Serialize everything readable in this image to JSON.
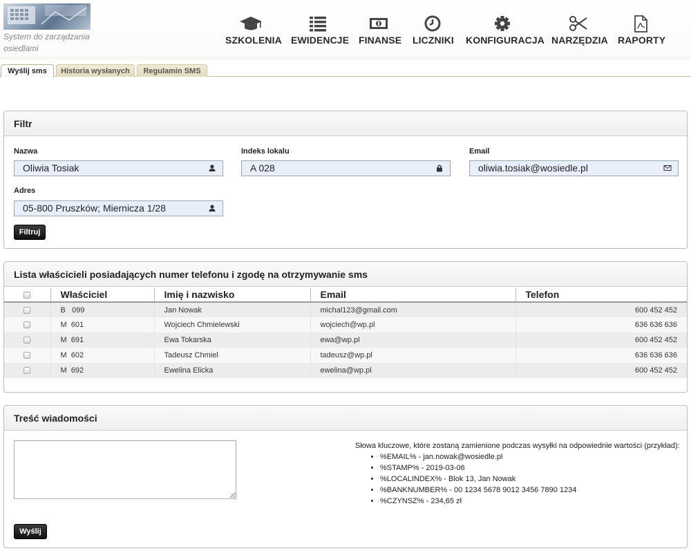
{
  "header": {
    "tagline": "System do zarządzania osiedlami",
    "nav": [
      {
        "label": "SZKOLENIA",
        "icon": "graduation-cap-icon"
      },
      {
        "label": "EWIDENCJE",
        "icon": "list-icon"
      },
      {
        "label": "FINANSE",
        "icon": "money-icon"
      },
      {
        "label": "LICZNIKI",
        "icon": "clock-icon"
      },
      {
        "label": "KONFIGURACJA",
        "icon": "gear-icon"
      },
      {
        "label": "NARZĘDZIA",
        "icon": "scissors-icon"
      },
      {
        "label": "RAPORTY",
        "icon": "pdf-file-icon"
      }
    ]
  },
  "tabs": [
    {
      "label": "Wyślij sms",
      "active": true
    },
    {
      "label": "Historia wysłanych",
      "active": false
    },
    {
      "label": "Regulamin SMS",
      "active": false
    }
  ],
  "filter": {
    "title": "Filtr",
    "nazwa": {
      "label": "Nazwa",
      "value": "Oliwia Tosiak",
      "icon": "user-icon"
    },
    "indeks": {
      "label": "Indeks lokalu",
      "value": "A 028",
      "icon": "lock-icon"
    },
    "email": {
      "label": "Email",
      "value": "oliwia.tosiak@wosiedle.pl",
      "icon": "envelope-icon"
    },
    "adres": {
      "label": "Adres",
      "value": "05-800 Pruszków; Miernicza 1/28",
      "icon": "user-icon"
    },
    "button": "Filtruj"
  },
  "owners": {
    "title": "Lista właścicieli posiadających numer telefonu i zgodę na otrzymywanie sms",
    "columns": [
      "Właściciel",
      "Imię i nazwisko",
      "Email",
      "Telefon"
    ],
    "rows": [
      {
        "owner": "B   099",
        "name": "Jan Nowak",
        "email": "michal123@gmail.com",
        "phone": "600 452 452"
      },
      {
        "owner": "M  601",
        "name": "Wojciech Chmielewski",
        "email": "wojciech@wp.pl",
        "phone": "636 636 636"
      },
      {
        "owner": "M  691",
        "name": "Ewa Tokarska",
        "email": "ewa@wp.pl",
        "phone": "600 452 452"
      },
      {
        "owner": "M  602",
        "name": "Tadeusz Chmiel",
        "email": "tadeusz@wp.pl",
        "phone": "636 636 636"
      },
      {
        "owner": "M  692",
        "name": "Ewelina Elicka",
        "email": "ewelina@wp.pl",
        "phone": "600 452 452"
      }
    ]
  },
  "message": {
    "title": "Treść wiadomości",
    "text": "",
    "keywords_intro": "Słowa kluczowe, które zostaną zamienione podczas wysyłki na odpowiednie wartości (przykład):",
    "keywords": [
      "%EMAIL% - jan.nowak@wosiedle.pl",
      "%STAMP% - 2019-03-06",
      "%LOCALINDEX% - Blok 13, Jan Nowak",
      "%BANKNUMBER% - 00 1234 5678 9012 3456 7890 1234",
      "%CZYNSZ% - 234,65 zł"
    ],
    "button": "Wyślij"
  }
}
